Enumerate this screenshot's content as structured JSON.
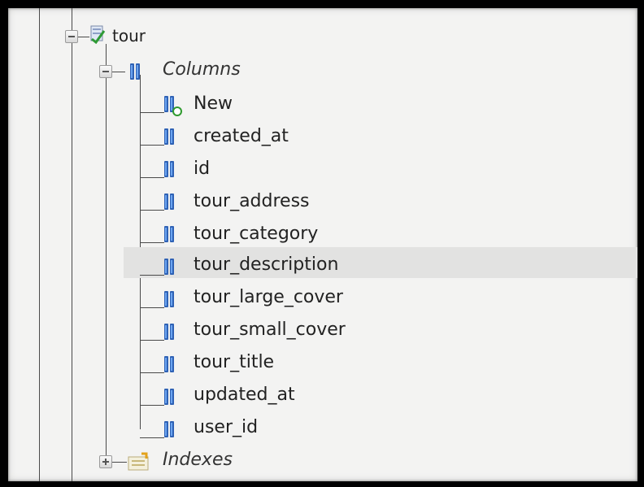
{
  "tree": {
    "table": {
      "name": "tour"
    },
    "columns_folder": {
      "label": "Columns",
      "expanded": true
    },
    "columns": [
      {
        "label": "New",
        "icon": "new-column-icon"
      },
      {
        "label": "created_at",
        "icon": "column-icon"
      },
      {
        "label": "id",
        "icon": "column-icon"
      },
      {
        "label": "tour_address",
        "icon": "column-icon"
      },
      {
        "label": "tour_category",
        "icon": "column-icon"
      },
      {
        "label": "tour_description",
        "icon": "column-icon",
        "selected": true
      },
      {
        "label": "tour_large_cover",
        "icon": "column-icon"
      },
      {
        "label": "tour_small_cover",
        "icon": "column-icon"
      },
      {
        "label": "tour_title",
        "icon": "column-icon"
      },
      {
        "label": "updated_at",
        "icon": "column-icon"
      },
      {
        "label": "user_id",
        "icon": "column-icon"
      }
    ],
    "indexes_folder": {
      "label": "Indexes",
      "expanded": false
    }
  },
  "colors": {
    "column_icon": "#2f62b5",
    "selection": "#e2e2e1",
    "tree_line": "#4a4a4a",
    "frame_border": "#000000"
  }
}
